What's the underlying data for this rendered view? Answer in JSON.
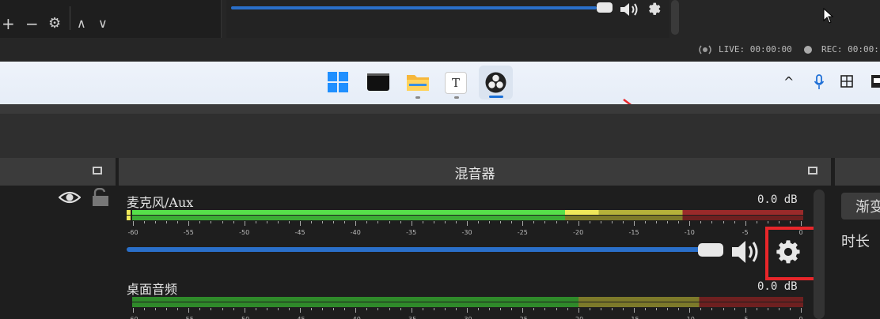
{
  "obs_top": {
    "toolbar_add": "+",
    "toolbar_remove": "−",
    "toolbar_settings": "⚙",
    "toolbar_up": "∧",
    "toolbar_down": "∨",
    "live_status": "LIVE: 00:00:00",
    "rec_status": "REC: 00:00:"
  },
  "taskbar": {
    "apps": [
      "windows-start",
      "terminal",
      "file-explorer",
      "typora",
      "obs-studio"
    ],
    "tray_chevron": "^"
  },
  "mixer": {
    "title": "混音器",
    "channels": [
      {
        "name": "麦克风/Aux",
        "db": "0.0 dB"
      },
      {
        "name": "桌面音频",
        "db": "0.0 dB"
      }
    ],
    "ticks": [
      "-60",
      "-55",
      "-50",
      "-45",
      "-40",
      "-35",
      "-30",
      "-25",
      "-20",
      "-15",
      "-10",
      "-5",
      "0"
    ]
  },
  "right_dock": {
    "button_label": "渐变",
    "label": "时长"
  },
  "colors": {
    "highlight": "#e8262a",
    "slider": "#2a6fc9",
    "meter_green": "#56e04a",
    "meter_yellow": "#c8c634",
    "meter_red": "#9a2a2a"
  }
}
